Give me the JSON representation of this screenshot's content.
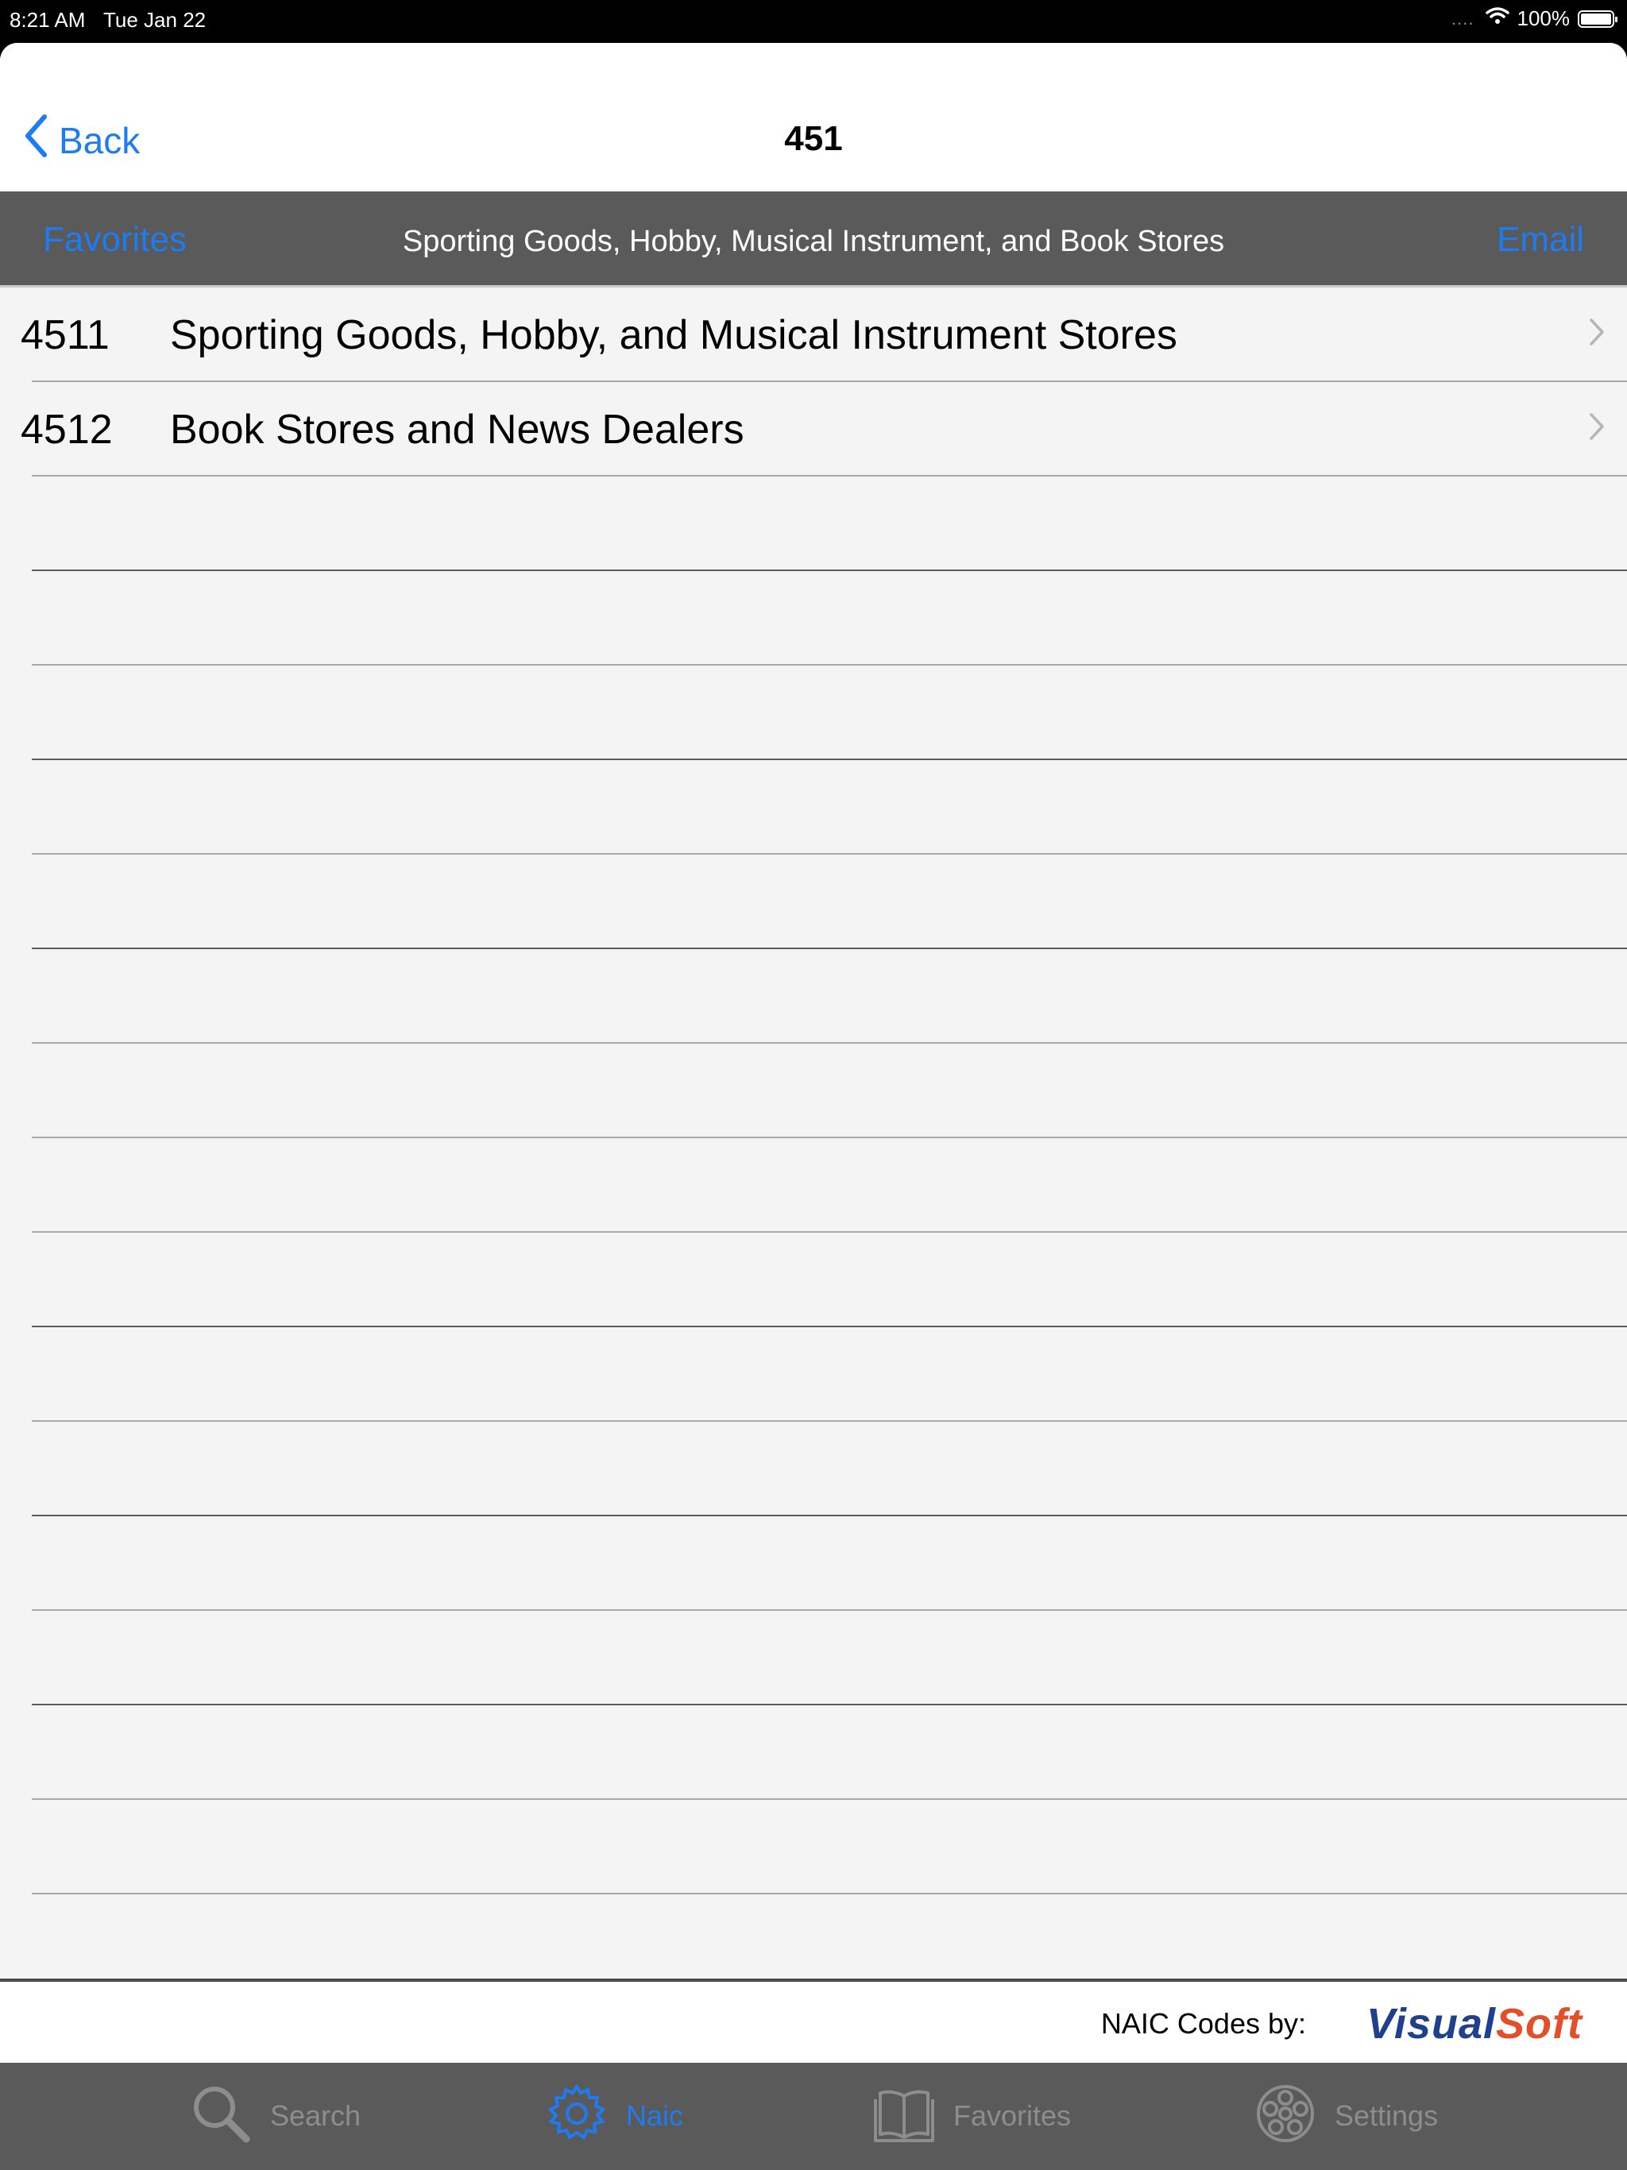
{
  "status_bar": {
    "time": "8:21 AM",
    "date": "Tue Jan 22",
    "signal_dots": "....",
    "battery": "100%",
    "battery_level": 1.0
  },
  "nav": {
    "back_label": "Back",
    "title": "451"
  },
  "toolbar": {
    "favorites_label": "Favorites",
    "title": "Sporting Goods, Hobby, Musical Instrument, and Book Stores",
    "email_label": "Email"
  },
  "rows": [
    {
      "code": "4511",
      "title": "Sporting Goods, Hobby, and Musical Instrument Stores"
    },
    {
      "code": "4512",
      "title": "Book Stores and News Dealers"
    }
  ],
  "footer": {
    "label": "NAIC Codes by:",
    "logo_part1": "Visual",
    "logo_part2": "Soft"
  },
  "tabs": [
    {
      "label": "Search",
      "icon": "search-icon",
      "active": false
    },
    {
      "label": "Naic",
      "icon": "gear-icon",
      "active": true
    },
    {
      "label": "Favorites",
      "icon": "book-icon",
      "active": false
    },
    {
      "label": "Settings",
      "icon": "film-reel-icon",
      "active": false
    }
  ],
  "colors": {
    "accent": "#1e7cf2",
    "toolbar_bg": "#5a5a5a",
    "logo_blue": "#1f3f8f",
    "logo_orange": "#e2502a"
  }
}
